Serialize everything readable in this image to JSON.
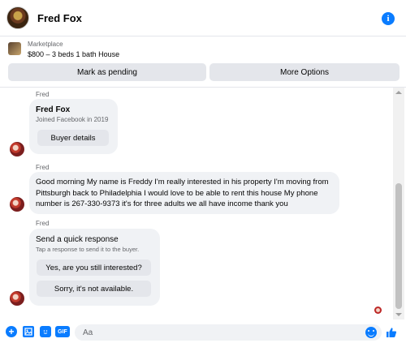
{
  "header": {
    "title": "Fred Fox",
    "info_icon": "info-icon"
  },
  "listing": {
    "category": "Marketplace",
    "title": "$800 – 3 beds 1 bath House",
    "mark_pending_label": "Mark as pending",
    "more_options_label": "More Options"
  },
  "messages": [
    {
      "sender": "Fred",
      "type": "profile_card",
      "name": "Fred Fox",
      "subtitle": "Joined Facebook in 2019",
      "button_label": "Buyer details"
    },
    {
      "sender": "Fred",
      "type": "text",
      "text": "Good morning My name is Freddy I'm really interested in his property I'm moving from Pittsburgh back to Philadelphia I would love to be able to rent this house My phone number is 267-330-9373 it's for three adults we all have income thank you"
    },
    {
      "sender": "Fred",
      "type": "quick_response",
      "title": "Send a quick response",
      "subtitle": "Tap a response to send it to the buyer.",
      "responses": [
        "Yes, are you still interested?",
        "Sorry, it's not available."
      ]
    }
  ],
  "composer": {
    "placeholder": "Aa",
    "gif_label": "GIF",
    "icons": [
      "plus-icon",
      "image-icon",
      "sticker-icon",
      "gif-icon",
      "emoji-icon",
      "thumbs-up-icon"
    ]
  },
  "colors": {
    "accent": "#0a7cff",
    "bubble": "#f0f2f5",
    "button": "#e4e6eb",
    "secondary_text": "#65676b"
  }
}
